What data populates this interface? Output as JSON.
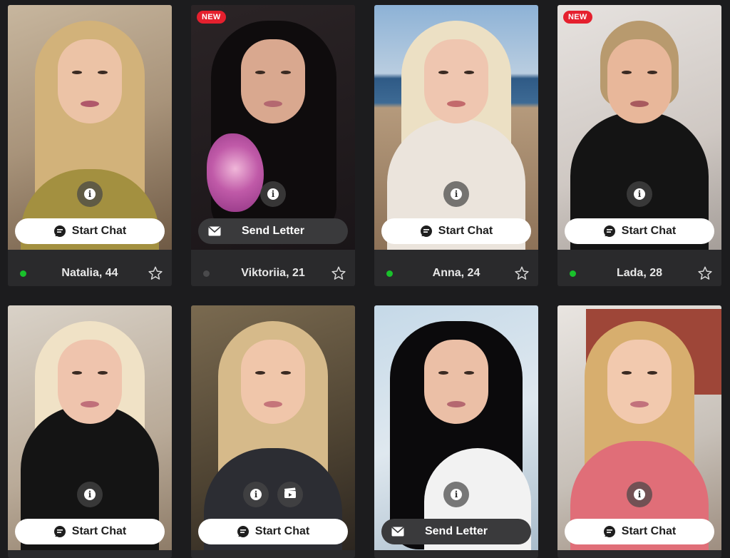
{
  "colors": {
    "page_bg": "#1c1c1e",
    "card_bg": "#2a2a2c",
    "online": "#19c12b",
    "offline": "#4a4a4c",
    "new_badge": "#e5202e"
  },
  "labels": {
    "new_badge": "NEW",
    "start_chat": "Start Chat",
    "send_letter": "Send Letter",
    "info_glyph": "i"
  },
  "profiles": [
    {
      "name_age": "Natalia, 44",
      "status": "online",
      "is_new": false,
      "action": "Start Chat"
    },
    {
      "name_age": "Viktoriia, 21",
      "status": "offline",
      "is_new": true,
      "action": "Send Letter"
    },
    {
      "name_age": "Anna, 24",
      "status": "online",
      "is_new": false,
      "action": "Start Chat"
    },
    {
      "name_age": "Lada, 28",
      "status": "online",
      "is_new": true,
      "action": "Start Chat"
    },
    {
      "name_age": "",
      "status": "",
      "is_new": false,
      "action": "Start Chat"
    },
    {
      "name_age": "",
      "status": "",
      "is_new": false,
      "action": "Start Chat",
      "has_video": true
    },
    {
      "name_age": "",
      "status": "",
      "is_new": false,
      "action": "Send Letter"
    },
    {
      "name_age": "",
      "status": "",
      "is_new": false,
      "action": "Start Chat"
    }
  ]
}
